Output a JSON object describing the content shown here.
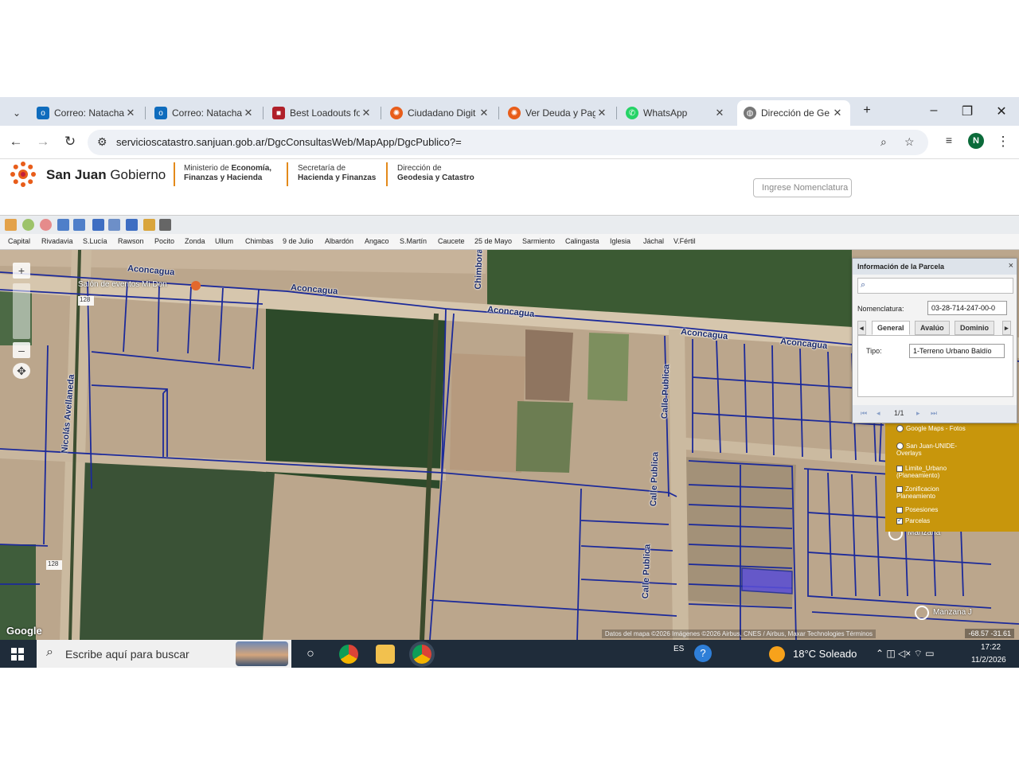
{
  "browser": {
    "tabs": [
      {
        "label": "Correo: Natacha",
        "icon": "outlook-icon",
        "color": "#0f6cbd"
      },
      {
        "label": "Correo: Natacha",
        "icon": "outlook-icon",
        "color": "#0f6cbd"
      },
      {
        "label": "Best Loadouts fo",
        "icon": "loadout-icon",
        "color": "#b0202a"
      },
      {
        "label": "Ciudadano Digit",
        "icon": "sanjuan-sun-icon",
        "color": "#e85d1a"
      },
      {
        "label": "Ver Deuda y Pag",
        "icon": "sanjuan-sun-icon",
        "color": "#e85d1a"
      },
      {
        "label": "WhatsApp",
        "icon": "whatsapp-icon",
        "color": "#25d366"
      },
      {
        "label": "Dirección de Ge",
        "icon": "globe-icon",
        "color": "#555555"
      }
    ],
    "new_tab": "+",
    "url": "servicioscatastro.sanjuan.gob.ar/DgcConsultasWeb/MapApp/DgcPublico?=",
    "profile_initial": "N"
  },
  "header": {
    "brand_bold": "San Juan",
    "brand_light": " Gobierno",
    "ministry_line1_pre": "Ministerio de ",
    "ministry_line1_bold": "Economía,",
    "ministry_line2": "Finanzas y Hacienda",
    "secretaria_line1": "Secretaría de",
    "secretaria_line2": "Hacienda y Finanzas",
    "direccion_line1": "Dirección de",
    "direccion_line2": "Geodesia y Catastro",
    "search_placeholder": "Ingrese Nomenclatura"
  },
  "departments": [
    "Capital",
    "Rivadavia",
    "S.Lucía",
    "Rawson",
    "Pocito",
    "Zonda",
    "Ullum",
    "Chimbas",
    "9 de Julio",
    "Albardón",
    "Angaco",
    "S.Martín",
    "Caucete",
    "25 de Mayo",
    "Sarmiento",
    "Calingasta",
    "Iglesia",
    "Jáchal",
    "V.Fértil"
  ],
  "map": {
    "roads": [
      {
        "label": "Aconcagua"
      },
      {
        "label": "Aconcagua"
      },
      {
        "label": "Aconcagua"
      },
      {
        "label": "Aconcagua"
      },
      {
        "label": "Aconcagua"
      },
      {
        "label": "Nicolás Avellaneda"
      },
      {
        "label": "Chimbora"
      },
      {
        "label": "Calle Publica"
      },
      {
        "label": "Calle Publica"
      },
      {
        "label": "Calle Publica"
      }
    ],
    "poi": "Salón de eventos Mi Don",
    "route_badge_1": "128",
    "route_badge_2": "128",
    "manzana_1": "Manzana",
    "manzana_2": "Manzana J",
    "google": "Google",
    "attribution": "Datos del mapa ©2026 Imágenes ©2026 Airbus, CNES / Airbus, Maxar Technologies   Términos",
    "coords": "-68.57 -31.61"
  },
  "layers": [
    {
      "label": "Google Maps - Fotos",
      "type": "radio",
      "checked": false
    },
    {
      "label": "San Juan-UNIDE-Overlays",
      "type": "radio",
      "checked": false
    },
    {
      "label": "Limite_Urbano (Planeamiento)",
      "type": "checkbox",
      "checked": false
    },
    {
      "label": "Zonificacion Planeamiento",
      "type": "checkbox",
      "checked": false
    },
    {
      "label": "Posesiones",
      "type": "checkbox",
      "checked": false
    },
    {
      "label": "Parcelas",
      "type": "checkbox",
      "checked": true
    }
  ],
  "info_panel": {
    "title": "Información de la Parcela",
    "close": "×",
    "nomenclatura_label": "Nomenclatura:",
    "nomenclatura_value": "03-28-714-247-00-0",
    "tabs": [
      "General",
      "Avalúo",
      "Dominio"
    ],
    "tipo_label": "Tipo:",
    "tipo_value": "1-Terreno Urbano Baldío",
    "pager": "1/1"
  },
  "taskbar": {
    "search_placeholder": "Escribe aquí para buscar",
    "lang": "ES",
    "weather": "18°C  Soleado",
    "time": "17:22",
    "date": "11/2/2026"
  }
}
